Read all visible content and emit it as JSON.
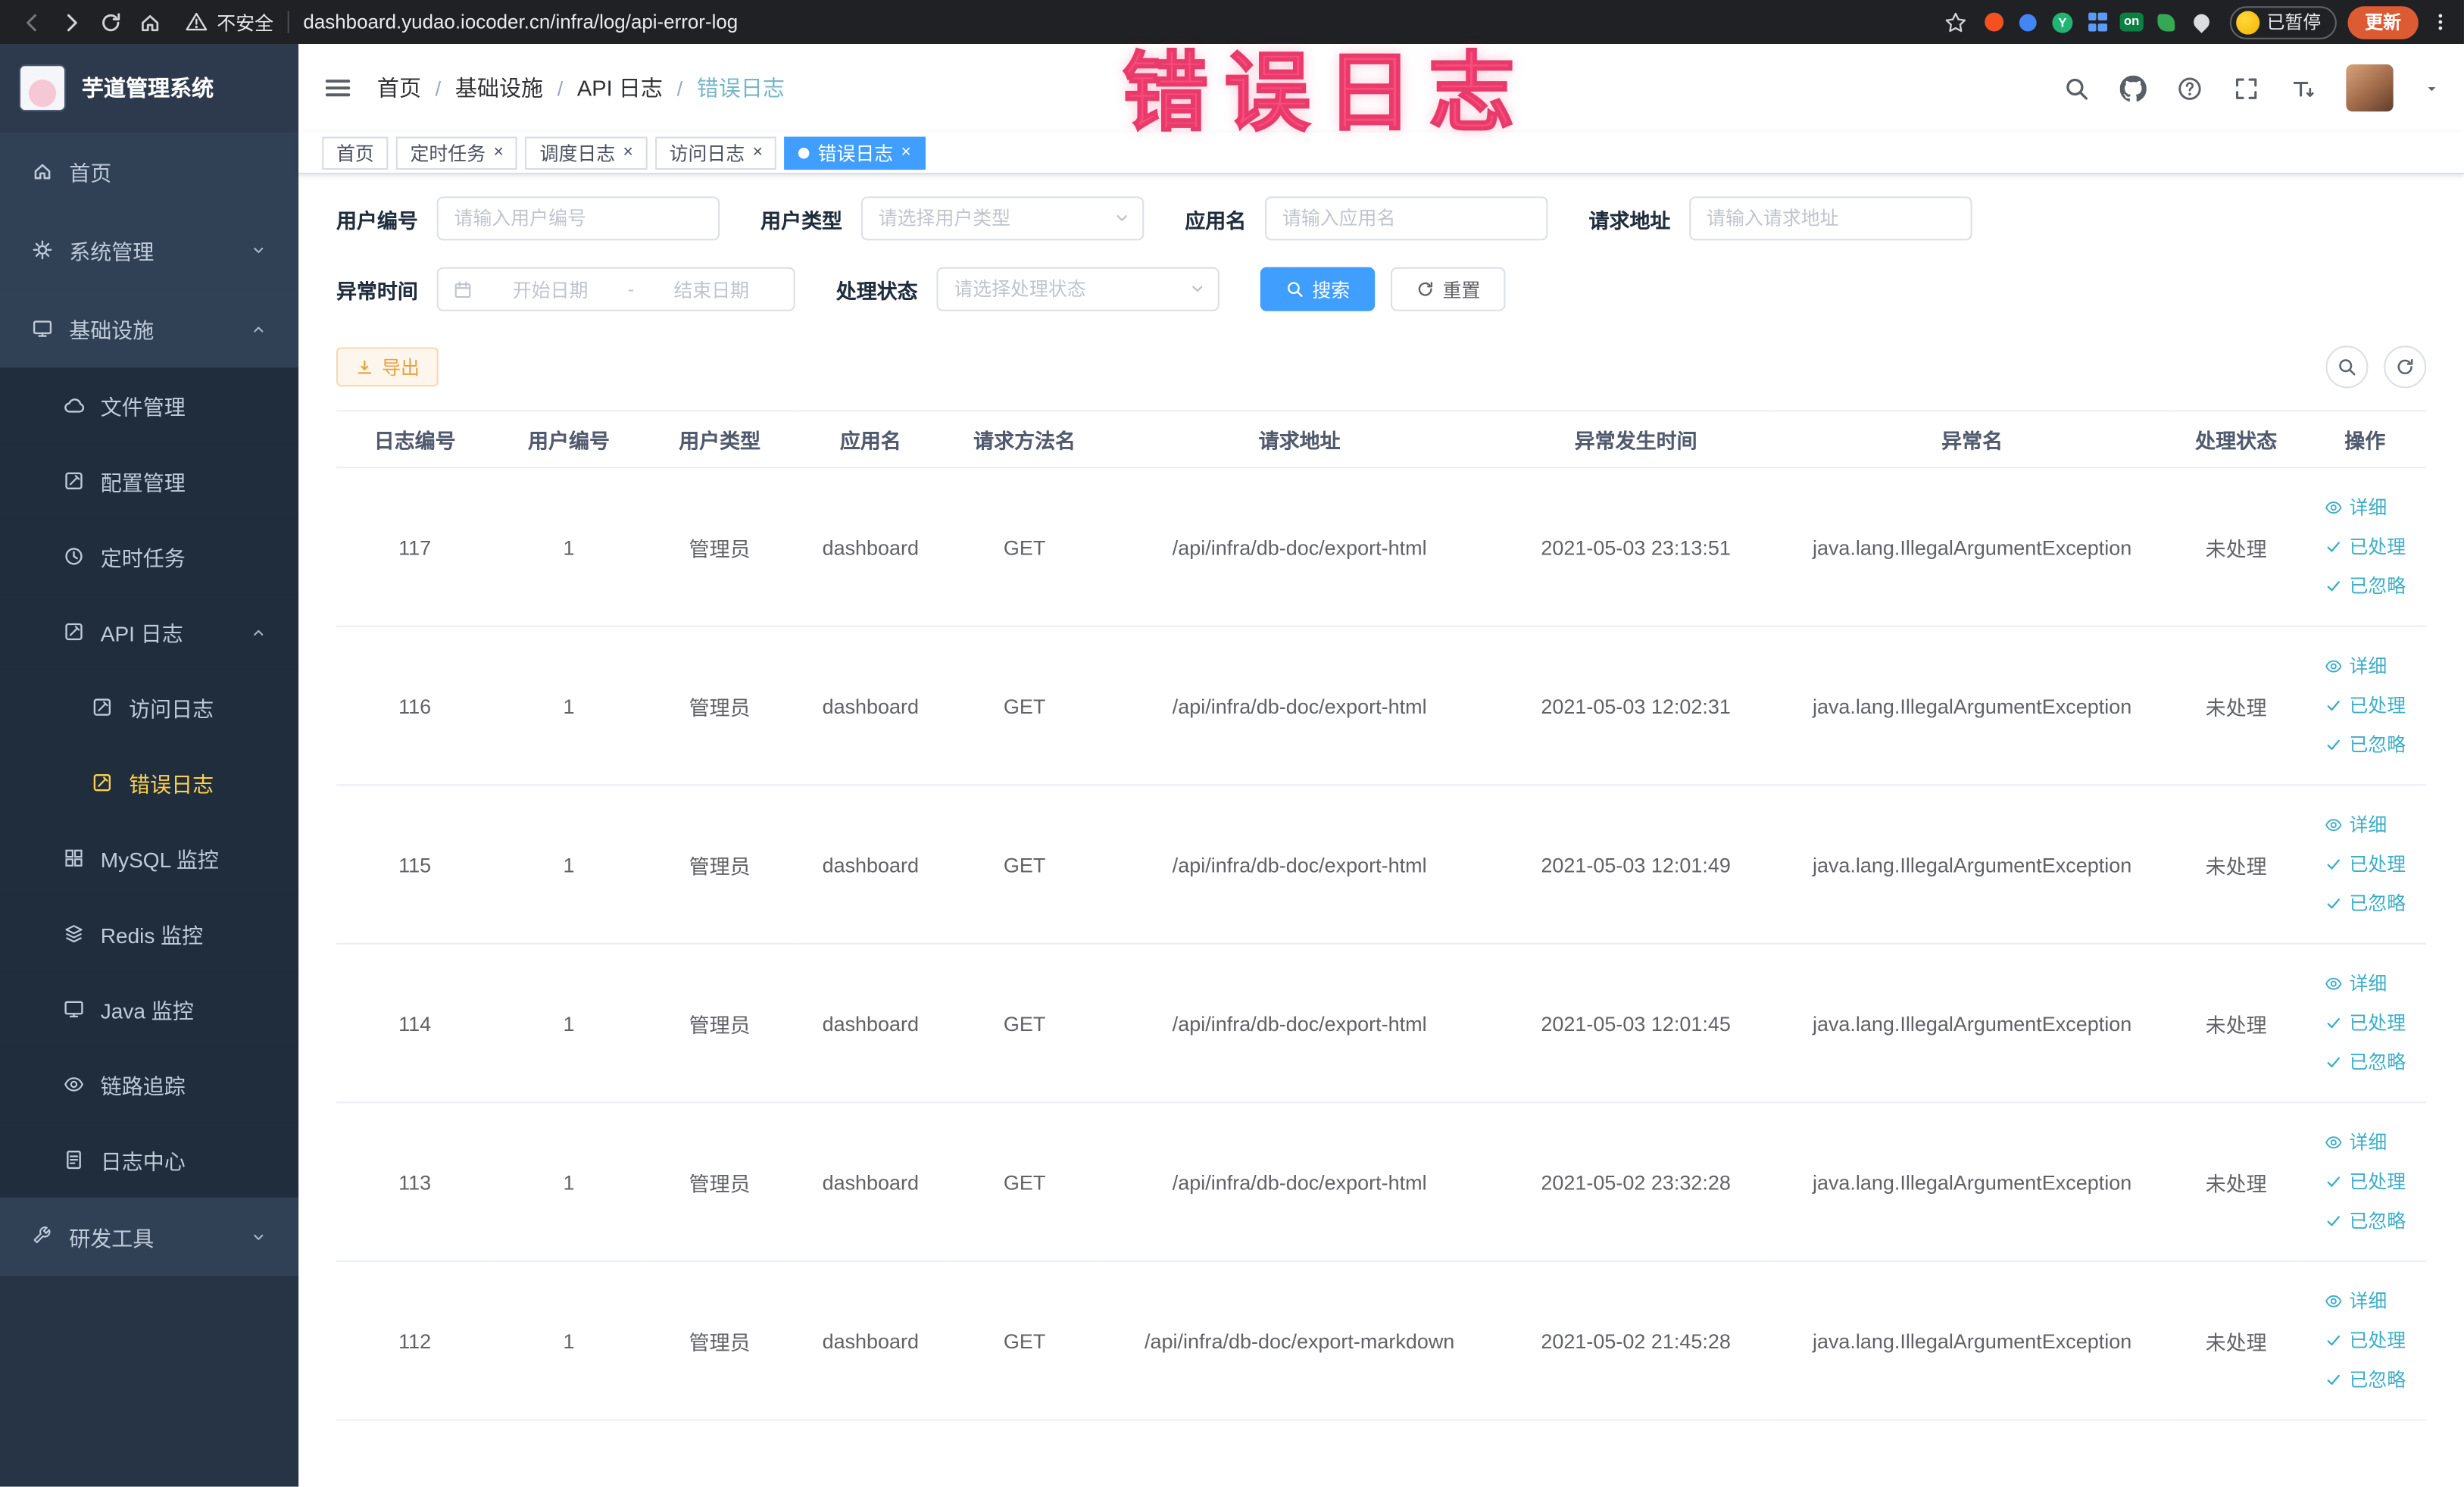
{
  "browser": {
    "security_label": "不安全",
    "url": "dashboard.yudao.iocoder.cn/infra/log/api-error-log",
    "ext_on_label": "on",
    "ext_y_label": "Y",
    "profile_badge": "已暂停",
    "update_button": "更新"
  },
  "watermark": "错误日志",
  "sidebar": {
    "title": "芋道管理系统",
    "home": "首页",
    "system_mgmt": "系统管理",
    "infrastructure": "基础设施",
    "file_mgmt": "文件管理",
    "config_mgmt": "配置管理",
    "scheduled_jobs": "定时任务",
    "api_log": "API 日志",
    "access_log": "访问日志",
    "error_log": "错误日志",
    "mysql_monitor": "MySQL 监控",
    "redis_monitor": "Redis 监控",
    "java_monitor": "Java 监控",
    "trace": "链路追踪",
    "log_center": "日志中心",
    "dev_tools": "研发工具"
  },
  "breadcrumb": {
    "items": [
      "首页",
      "基础设施",
      "API 日志",
      "错误日志"
    ],
    "separator": "/"
  },
  "tabs": [
    {
      "label": "首页"
    },
    {
      "label": "定时任务"
    },
    {
      "label": "调度日志"
    },
    {
      "label": "访问日志"
    },
    {
      "label": "错误日志"
    }
  ],
  "filters": {
    "user_id_label": "用户编号",
    "user_id_placeholder": "请输入用户编号",
    "user_type_label": "用户类型",
    "user_type_placeholder": "请选择用户类型",
    "app_name_label": "应用名",
    "app_name_placeholder": "请输入应用名",
    "request_url_label": "请求地址",
    "request_url_placeholder": "请输入请求地址",
    "exception_time_label": "异常时间",
    "start_date_placeholder": "开始日期",
    "date_separator": "-",
    "end_date_placeholder": "结束日期",
    "process_status_label": "处理状态",
    "process_status_placeholder": "请选择处理状态",
    "search_button": "搜索",
    "reset_button": "重置"
  },
  "toolbar": {
    "export_button": "导出"
  },
  "table": {
    "headers": [
      "日志编号",
      "用户编号",
      "用户类型",
      "应用名",
      "请求方法名",
      "请求地址",
      "异常发生时间",
      "异常名",
      "处理状态",
      "操作"
    ],
    "actions": {
      "detail": "详细",
      "processed": "已处理",
      "ignored": "已忽略"
    },
    "rows": [
      {
        "id": "117",
        "user_id": "1",
        "user_type": "管理员",
        "app": "dashboard",
        "method": "GET",
        "url": "/api/infra/db-doc/export-html",
        "time": "2021-05-03 23:13:51",
        "exception": "java.lang.IllegalArgumentException",
        "status": "未处理"
      },
      {
        "id": "116",
        "user_id": "1",
        "user_type": "管理员",
        "app": "dashboard",
        "method": "GET",
        "url": "/api/infra/db-doc/export-html",
        "time": "2021-05-03 12:02:31",
        "exception": "java.lang.IllegalArgumentException",
        "status": "未处理"
      },
      {
        "id": "115",
        "user_id": "1",
        "user_type": "管理员",
        "app": "dashboard",
        "method": "GET",
        "url": "/api/infra/db-doc/export-html",
        "time": "2021-05-03 12:01:49",
        "exception": "java.lang.IllegalArgumentException",
        "status": "未处理"
      },
      {
        "id": "114",
        "user_id": "1",
        "user_type": "管理员",
        "app": "dashboard",
        "method": "GET",
        "url": "/api/infra/db-doc/export-html",
        "time": "2021-05-03 12:01:45",
        "exception": "java.lang.IllegalArgumentException",
        "status": "未处理"
      },
      {
        "id": "113",
        "user_id": "1",
        "user_type": "管理员",
        "app": "dashboard",
        "method": "GET",
        "url": "/api/infra/db-doc/export-html",
        "time": "2021-05-02 23:32:28",
        "exception": "java.lang.IllegalArgumentException",
        "status": "未处理"
      },
      {
        "id": "112",
        "user_id": "1",
        "user_type": "管理员",
        "app": "dashboard",
        "method": "GET",
        "url": "/api/infra/db-doc/export-markdown",
        "time": "2021-05-02 21:45:28",
        "exception": "java.lang.IllegalArgumentException",
        "status": "未处理"
      }
    ]
  },
  "colors": {
    "accent": "#409eff",
    "sidebar_active": "#ffd04b",
    "link_teal": "#3caec9",
    "warning": "#e6a23c",
    "watermark_pink": "#fa4d7c"
  }
}
